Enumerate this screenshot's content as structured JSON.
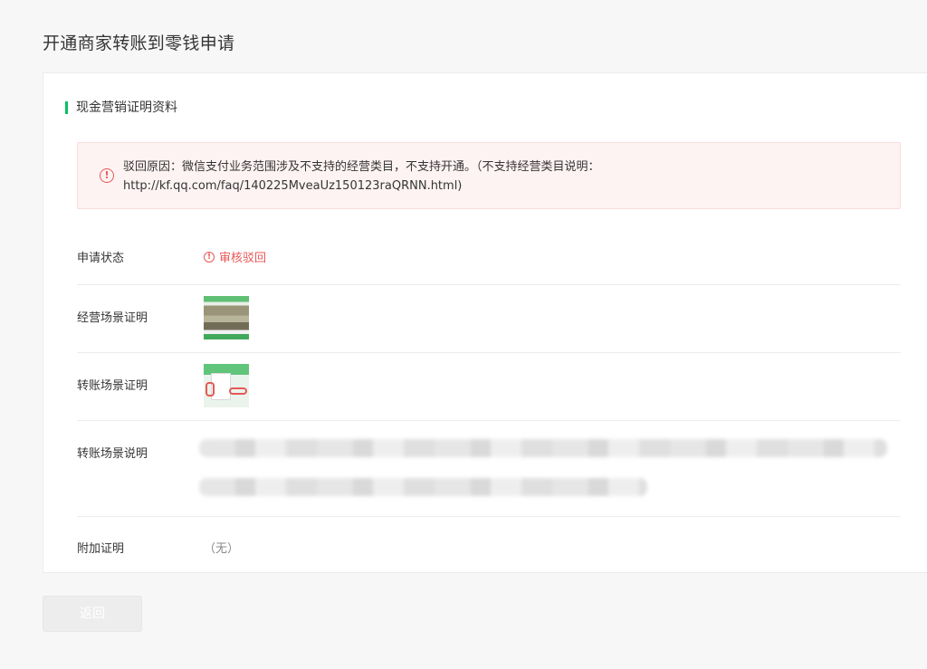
{
  "page": {
    "title": "开通商家转账到零钱申请"
  },
  "section": {
    "title": "现金营销证明资料"
  },
  "alert": {
    "icon": "exclamation-circle-icon",
    "line1": "驳回原因：微信支付业务范围涉及不支持的经营类目，不支持开通。（不支持经营类目说明：",
    "line2": "http://kf.qq.com/faq/140225MveaUz150123raQRNN.html)"
  },
  "fields": {
    "status": {
      "label": "申请状态",
      "value": "审核驳回",
      "icon": "exclamation-circle-icon",
      "color": "#e85757"
    },
    "business_scene_proof": {
      "label": "经营场景证明"
    },
    "transfer_scene_proof": {
      "label": "转账场景证明"
    },
    "transfer_scene_desc": {
      "label": "转账场景说明"
    },
    "additional_proof": {
      "label": "附加证明",
      "value": "（无）"
    }
  },
  "actions": {
    "back_label": "返回"
  },
  "colors": {
    "accent": "#07c160",
    "error": "#e85757",
    "error_bg": "#fef3f3"
  }
}
